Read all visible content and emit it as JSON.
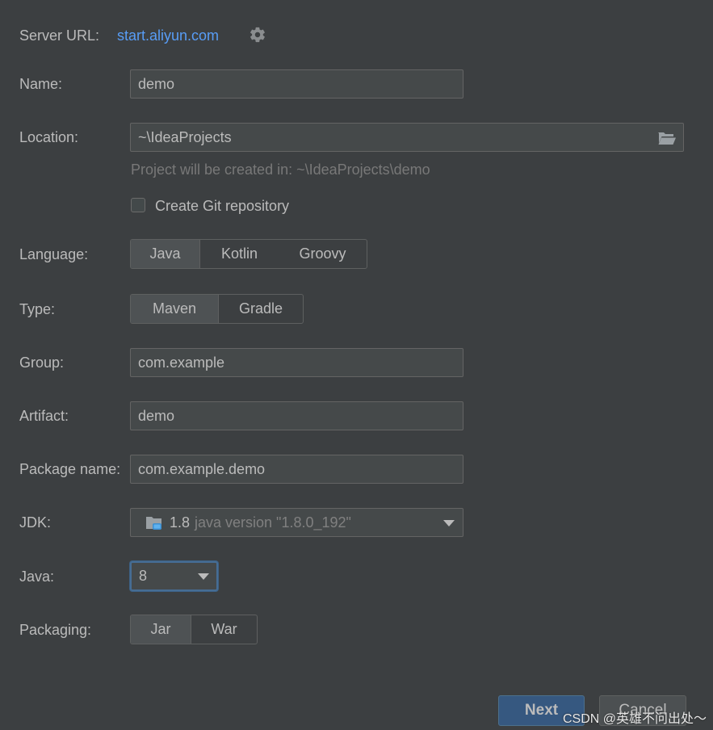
{
  "server_url": {
    "label": "Server URL:",
    "value": "start.aliyun.com",
    "gear_icon": "gear-icon"
  },
  "name": {
    "label": "Name:",
    "value": "demo"
  },
  "location": {
    "label": "Location:",
    "value": "~\\IdeaProjects",
    "icon": "folder-open-icon",
    "hint": "Project will be created in: ~\\IdeaProjects\\demo"
  },
  "git": {
    "label": "Create Git repository",
    "checked": false
  },
  "language": {
    "label": "Language:",
    "options": [
      "Java",
      "Kotlin",
      "Groovy"
    ],
    "selected": "Java"
  },
  "type": {
    "label": "Type:",
    "options": [
      "Maven",
      "Gradle"
    ],
    "selected": "Maven"
  },
  "group": {
    "label": "Group:",
    "value": "com.example"
  },
  "artifact": {
    "label": "Artifact:",
    "value": "demo"
  },
  "package_name": {
    "label": "Package name:",
    "value": "com.example.demo"
  },
  "jdk": {
    "label": "JDK:",
    "version": "1.8",
    "description": "java version \"1.8.0_192\"",
    "icon": "jdk-folder-icon"
  },
  "java": {
    "label": "Java:",
    "value": "8"
  },
  "packaging": {
    "label": "Packaging:",
    "options": [
      "Jar",
      "War"
    ],
    "selected": "Jar"
  },
  "buttons": {
    "next": "Next",
    "cancel": "Cancel"
  },
  "watermark": "CSDN @英雄不问出处～",
  "colors": {
    "background": "#3c3f41",
    "field": "#45494a",
    "link": "#589df6",
    "primary_button": "#365880",
    "focus": "#466d94"
  }
}
